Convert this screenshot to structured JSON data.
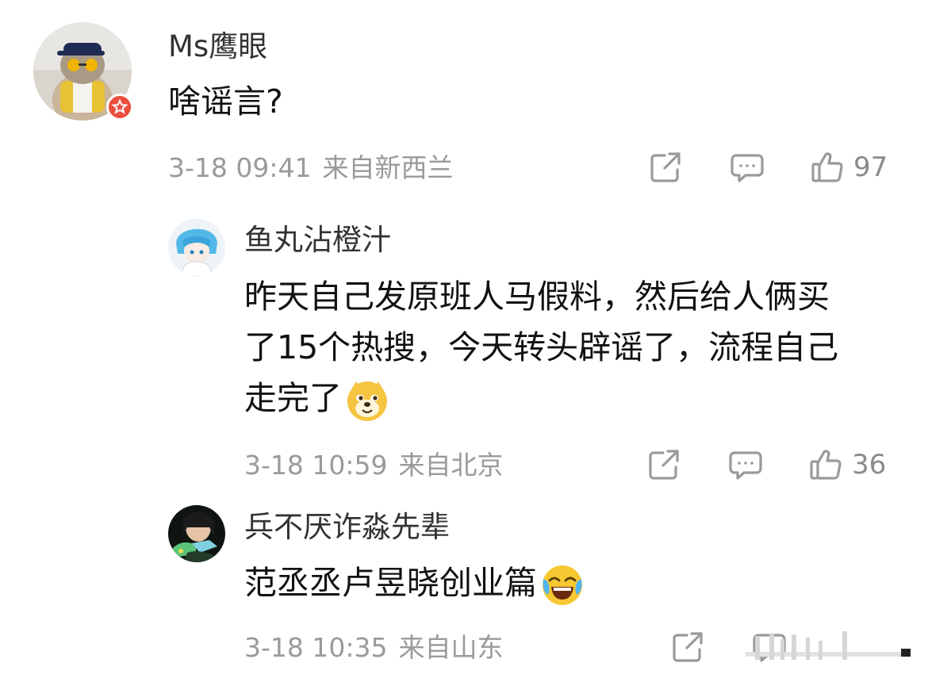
{
  "comments": [
    {
      "username": "Ms鹰眼",
      "lines": [
        "啥谣言?"
      ],
      "time": "3-18 09:41",
      "location": "来自新西兰",
      "like_count": "97"
    },
    {
      "username": "鱼丸沾橙汁",
      "lines": [
        "昨天自己发原班人马假料，然后给人俩买",
        "了15个热搜，今天转头辟谣了，流程自己",
        "走完了"
      ],
      "time": "3-18 10:59",
      "location": "来自北京",
      "like_count": "36",
      "emoji": "doge-emoji"
    },
    {
      "username": "兵不厌诈淼先辈",
      "lines": [
        "范丞丞卢昱晓创业篇"
      ],
      "time": "3-18 10:35",
      "location": "来自山东",
      "like_count": "",
      "emoji": "laugh-cry-emoji"
    }
  ],
  "icons": {
    "share": "share-icon",
    "comment": "comment-icon",
    "like": "thumbs-up-icon",
    "verified": "verified-badge-icon"
  },
  "colors": {
    "text": "#111111",
    "username": "#333333",
    "meta": "#9a9a9a",
    "badge": "#ec4d3c"
  }
}
